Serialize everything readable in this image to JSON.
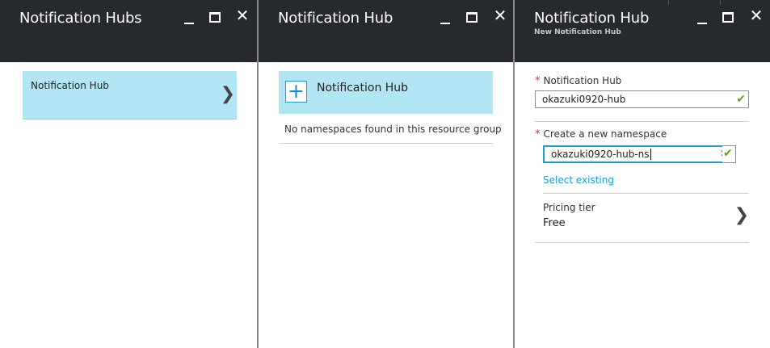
{
  "blade1": {
    "title": "Notification Hubs",
    "item_label": "Notification Hub",
    "controls": {
      "minimize": "minimize-icon",
      "maximize": "maximize-icon",
      "close": "close-icon"
    }
  },
  "blade2": {
    "title": "Notification Hub",
    "add_label": "Notification Hub",
    "empty_text": "No namespaces found in this resource group"
  },
  "blade3": {
    "title": "Notification Hub",
    "subtitle": "New Notification Hub",
    "hub_label": "Notification Hub",
    "hub_value": "okazuki0920-hub",
    "namespace_label": "Create a new namespace",
    "namespace_value": "okazuki0920-hub-ns",
    "select_existing": "Select existing",
    "pricing_label": "Pricing tier",
    "pricing_value": "Free",
    "required_mark": "*"
  },
  "colors": {
    "header_bg": "#262a2e",
    "selected_item_bg": "#b3e6f5",
    "link": "#1a9fd8",
    "valid_check": "#5ca51f",
    "required": "#d0342c"
  }
}
